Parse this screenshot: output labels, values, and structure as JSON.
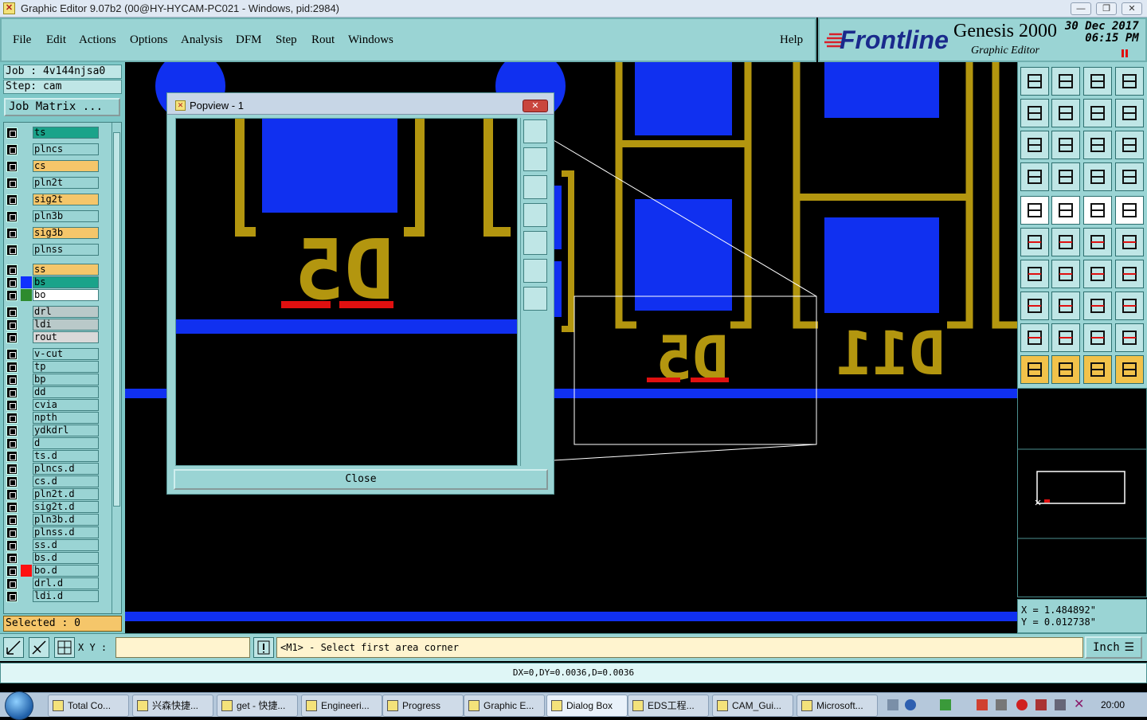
{
  "window": {
    "title": "Graphic Editor 9.07b2 (00@HY-HYCAM-PC021 - Windows, pid:2984)",
    "minimize": "—",
    "maximize": "❐",
    "close": "✕"
  },
  "menu": [
    {
      "label": "File"
    },
    {
      "label": "Edit"
    },
    {
      "label": "Actions"
    },
    {
      "label": "Options"
    },
    {
      "label": "Analysis"
    },
    {
      "label": "DFM"
    },
    {
      "label": "Step"
    },
    {
      "label": "Rout"
    },
    {
      "label": "Windows"
    }
  ],
  "help": "Help",
  "brand": {
    "logo": "Frontline",
    "product": "Genesis 2000",
    "subtitle": "Graphic Editor",
    "date": "30 Dec 2017",
    "time": "06:15 PM"
  },
  "job": {
    "job_line": "Job : 4v144njsa0",
    "step_line": "Step: cam",
    "matrix_button": "Job Matrix ..."
  },
  "layers": [
    {
      "name": "ts",
      "color": "#1aa38a",
      "swatch": ""
    },
    {
      "name": "plncs",
      "color": "#9ad4d4",
      "swatch": ""
    },
    {
      "name": "cs",
      "color": "#f5c66a",
      "swatch": ""
    },
    {
      "name": "pln2t",
      "color": "#9ad4d4",
      "swatch": ""
    },
    {
      "name": "sig2t",
      "color": "#f5c66a",
      "swatch": ""
    },
    {
      "name": "pln3b",
      "color": "#9ad4d4",
      "swatch": ""
    },
    {
      "name": "sig3b",
      "color": "#f5c66a",
      "swatch": ""
    },
    {
      "name": "plnss",
      "color": "#9ad4d4",
      "swatch": ""
    },
    {
      "name": "ss",
      "color": "#f5c66a",
      "swatch": ""
    },
    {
      "name": "bs",
      "color": "#1aa38a",
      "swatch": "#1030ff"
    },
    {
      "name": "bo",
      "color": "#ffffff",
      "swatch": "#2e8b2e"
    },
    {
      "name": "drl",
      "color": "#b9c9c9",
      "swatch": ""
    },
    {
      "name": "ldi",
      "color": "#b9c9c9",
      "swatch": ""
    },
    {
      "name": "rout",
      "color": "#d9d9d9",
      "swatch": ""
    },
    {
      "name": "v-cut",
      "color": "#9ad4d4",
      "swatch": ""
    },
    {
      "name": "tp",
      "color": "#9ad4d4",
      "swatch": ""
    },
    {
      "name": "bp",
      "color": "#9ad4d4",
      "swatch": ""
    },
    {
      "name": "dd",
      "color": "#9ad4d4",
      "swatch": ""
    },
    {
      "name": "cvia",
      "color": "#9ad4d4",
      "swatch": ""
    },
    {
      "name": "npth",
      "color": "#9ad4d4",
      "swatch": ""
    },
    {
      "name": "ydkdrl",
      "color": "#9ad4d4",
      "swatch": ""
    },
    {
      "name": "d",
      "color": "#9ad4d4",
      "swatch": ""
    },
    {
      "name": "ts.d",
      "color": "#9ad4d4",
      "swatch": ""
    },
    {
      "name": "plncs.d",
      "color": "#9ad4d4",
      "swatch": ""
    },
    {
      "name": "cs.d",
      "color": "#9ad4d4",
      "swatch": ""
    },
    {
      "name": "pln2t.d",
      "color": "#9ad4d4",
      "swatch": ""
    },
    {
      "name": "sig2t.d",
      "color": "#9ad4d4",
      "swatch": ""
    },
    {
      "name": "pln3b.d",
      "color": "#9ad4d4",
      "swatch": ""
    },
    {
      "name": "plnss.d",
      "color": "#9ad4d4",
      "swatch": ""
    },
    {
      "name": "ss.d",
      "color": "#9ad4d4",
      "swatch": ""
    },
    {
      "name": "bs.d",
      "color": "#9ad4d4",
      "swatch": ""
    },
    {
      "name": "bo.d",
      "color": "#9ad4d4",
      "swatch": "#ff1010"
    },
    {
      "name": "drl.d",
      "color": "#9ad4d4",
      "swatch": ""
    },
    {
      "name": "ldi.d",
      "color": "#9ad4d4",
      "swatch": ""
    }
  ],
  "selected": "Selected : 0",
  "canvas": {
    "label_d5": "D5",
    "label_d11": "D11",
    "colors": {
      "copper": "#b3960f",
      "pad": "#1030f0",
      "mask": "#e01010"
    }
  },
  "popview": {
    "title": "Popview - 1",
    "close_label": "Close",
    "label": "D5"
  },
  "coords": {
    "x": "X = 1.484892\"",
    "y": "Y = 0.012738\""
  },
  "cmd": {
    "xy_label": "X Y :",
    "xy_value": "",
    "message": "<M1> - Select first area corner",
    "unit": "Inch"
  },
  "status": "DX=0,DY=0.0036,D=0.0036",
  "taskbar": {
    "items": [
      "Total Co...",
      "兴森快捷...",
      "get - 快捷...",
      "Engineeri...",
      "Progress",
      "Graphic E...",
      "Dialog Box",
      "EDS工程...",
      "CAM_Gui...",
      "Microsoft..."
    ],
    "clock": "20:00"
  }
}
